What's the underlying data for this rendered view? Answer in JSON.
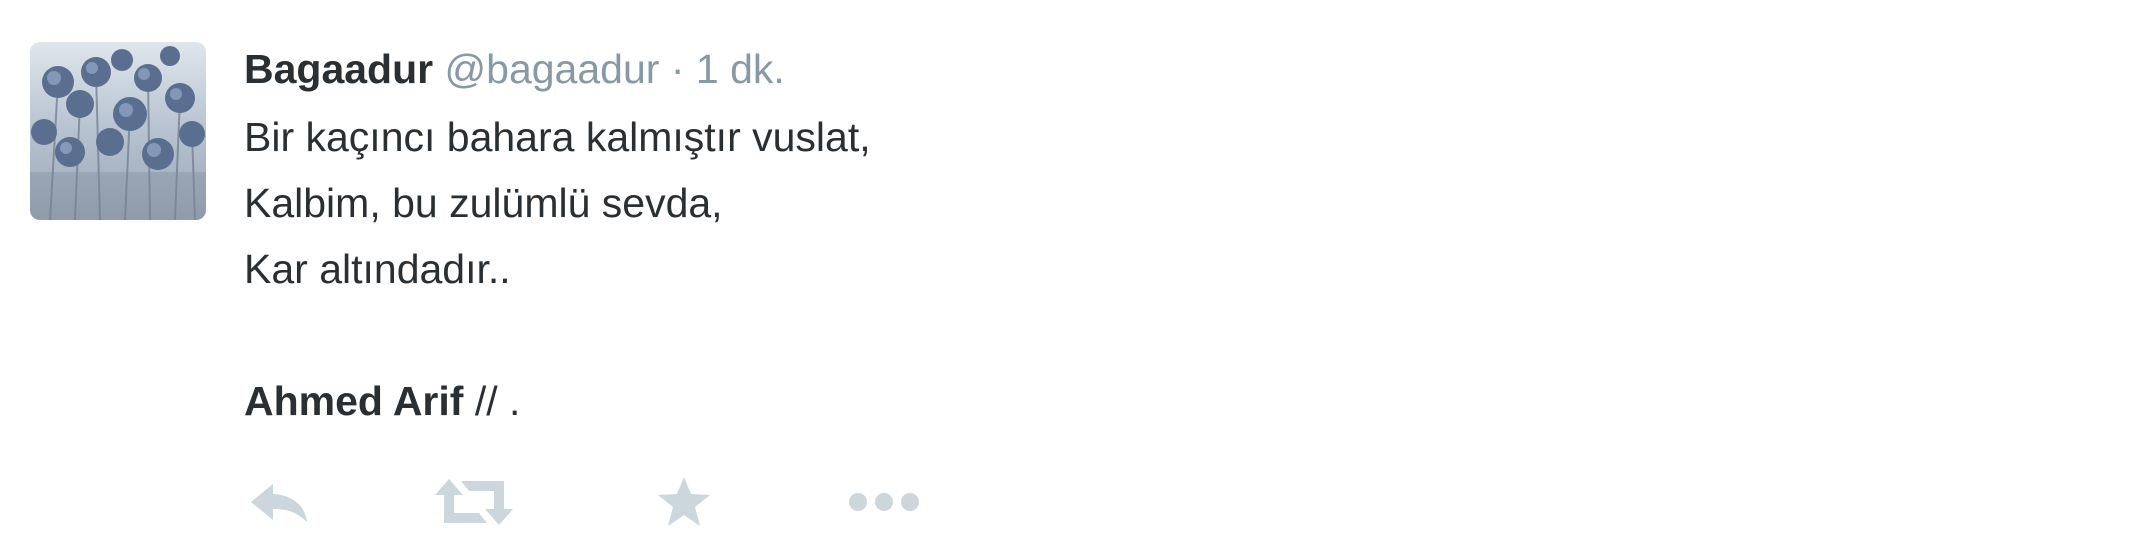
{
  "tweet": {
    "fullname": "Bagaadur",
    "username": "@bagaadur",
    "separator": "·",
    "time": "1 dk.",
    "lines": [
      "Bir kaçıncı bahara kalmıştır vuslat,",
      "Kalbim, bu zulümlü sevda,",
      "Kar altındadır.."
    ],
    "signature_bold": "Ahmed Arif",
    "signature_rest": " // ."
  },
  "actions": [
    {
      "name": "reply-icon"
    },
    {
      "name": "retweet-icon"
    },
    {
      "name": "favorite-star-icon"
    },
    {
      "name": "more-dots-icon"
    }
  ],
  "colors": {
    "text": "#292f33",
    "muted": "#8899a6",
    "action_icon": "#ccd6dd",
    "avatar_bg": "#b9c3cc"
  }
}
